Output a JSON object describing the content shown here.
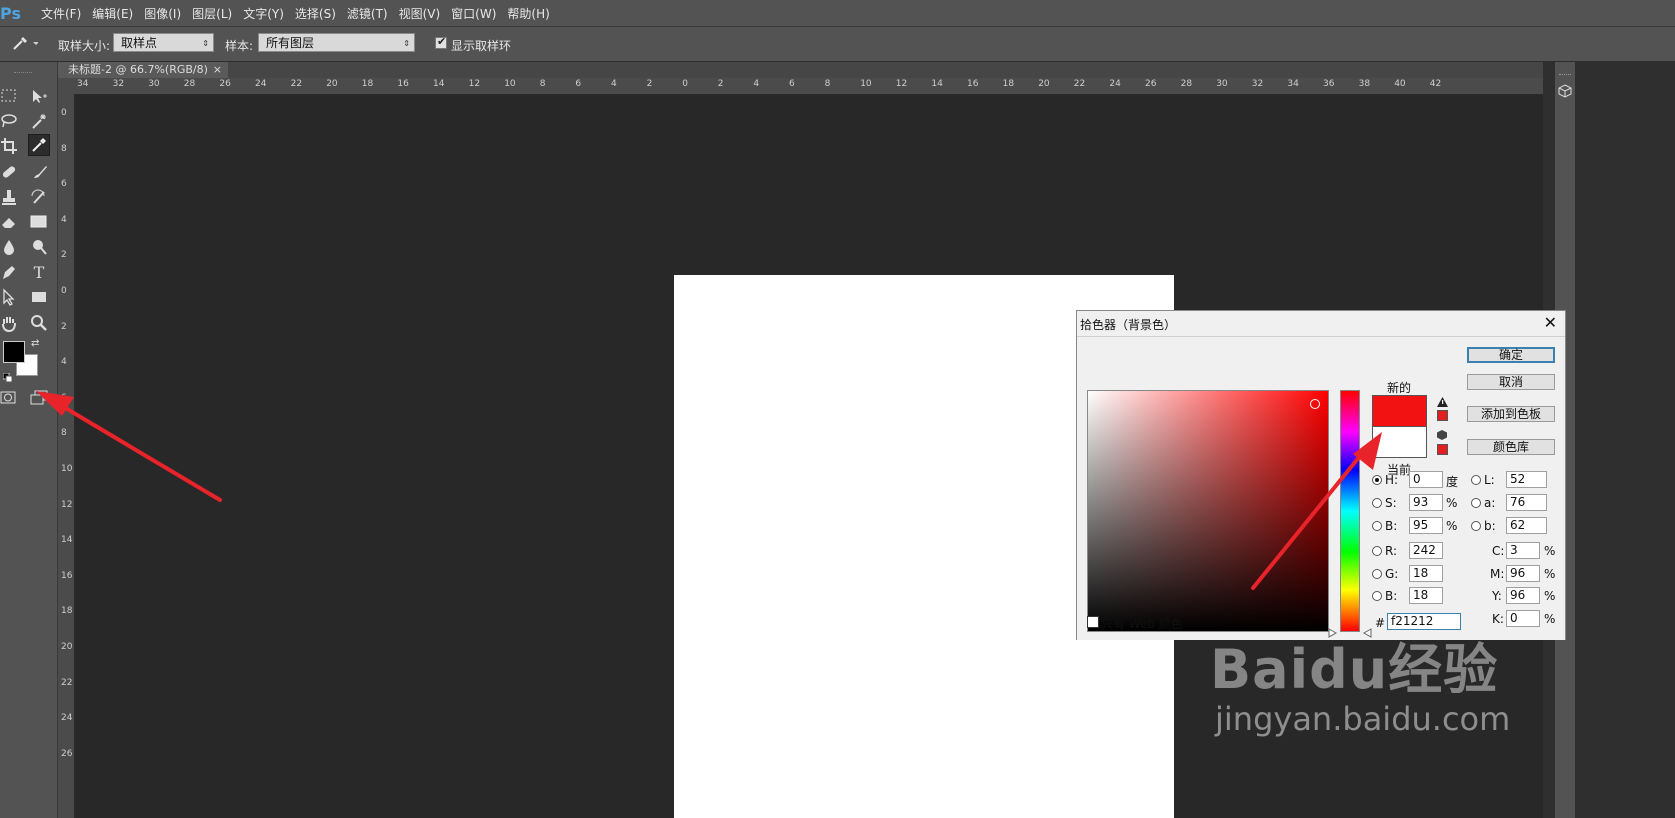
{
  "app": {
    "logo": "Ps"
  },
  "menu": [
    "文件(F)",
    "编辑(E)",
    "图像(I)",
    "图层(L)",
    "文字(Y)",
    "选择(S)",
    "滤镜(T)",
    "视图(V)",
    "窗口(W)",
    "帮助(H)"
  ],
  "options": {
    "sample_size_label": "取样大小:",
    "sample_size_value": "取样点",
    "sample_label": "样本:",
    "sample_value": "所有图层",
    "show_ring_label": "显示取样环",
    "show_ring_checked": true
  },
  "document": {
    "tab_title": "未标题-2 @ 66.7%(RGB/8)",
    "tab_close": "×"
  },
  "rulers": {
    "horizontal": [
      "34",
      "32",
      "30",
      "28",
      "26",
      "24",
      "22",
      "20",
      "18",
      "16",
      "14",
      "12",
      "10",
      "8",
      "6",
      "4",
      "2",
      "0",
      "2",
      "4",
      "6",
      "8",
      "10",
      "12",
      "14",
      "16",
      "18",
      "20",
      "22",
      "24",
      "26",
      "28",
      "30",
      "32",
      "34",
      "36",
      "38",
      "40",
      "42"
    ],
    "vertical": [
      "0",
      "8",
      "6",
      "4",
      "2",
      "0",
      "2",
      "4",
      "6",
      "8",
      "10",
      "12",
      "14",
      "16",
      "18",
      "20",
      "22",
      "24",
      "26"
    ]
  },
  "color_picker": {
    "title": "拾色器（背景色）",
    "close": "✕",
    "new_label": "新的",
    "current_label": "当前",
    "buttons": {
      "ok": "确定",
      "cancel": "取消",
      "add_to_swatches": "添加到色板",
      "color_libraries": "颜色库"
    },
    "web_only_label": "只有 Web 颜色",
    "hsb": {
      "h_label": "H:",
      "h": "0",
      "h_unit": "度",
      "s_label": "S:",
      "s": "93",
      "s_unit": "%",
      "b_label": "B:",
      "b": "95",
      "b_unit": "%"
    },
    "rgb": {
      "r_label": "R:",
      "r": "242",
      "g_label": "G:",
      "g": "18",
      "b_label": "B:",
      "b": "18"
    },
    "lab": {
      "l_label": "L:",
      "l": "52",
      "a_label": "a:",
      "a": "76",
      "b_label": "b:",
      "b": "62"
    },
    "cmyk": {
      "c_label": "C:",
      "c": "3",
      "m_label": "M:",
      "m": "96",
      "y_label": "Y:",
      "y": "96",
      "k_label": "K:",
      "k": "0",
      "unit": "%"
    },
    "hex_label": "#",
    "hex": "f21212",
    "new_color": "#f21212",
    "current_color": "#ffffff"
  },
  "watermark": {
    "brand": "Baidu经验",
    "url": "jingyan.baidu.com"
  },
  "colors": {
    "arrow": "#e8232a",
    "accent": "#3c7fb1"
  }
}
